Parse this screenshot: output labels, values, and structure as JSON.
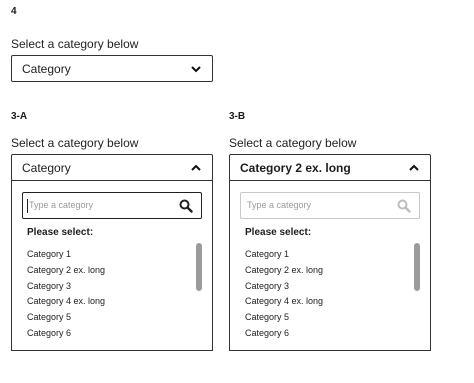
{
  "section4": {
    "label": "4",
    "prompt": "Select a category below",
    "select_value": "Category"
  },
  "section3a": {
    "label": "3-A",
    "prompt": "Select a category below",
    "select_value": "Category",
    "search_placeholder": "Type a category",
    "please_select": "Please select:",
    "options": [
      "Category 1",
      "Category 2 ex. long",
      "Category 3",
      "Category 4 ex. long",
      "Category 5",
      "Category 6"
    ]
  },
  "section3b": {
    "label": "3-B",
    "prompt": "Select a category below",
    "select_value": "Category 2 ex. long",
    "search_placeholder": "Type a category",
    "please_select": "Please select:",
    "options": [
      "Category 1",
      "Category 2 ex. long",
      "Category 3",
      "Category 4 ex. long",
      "Category 5",
      "Category 6"
    ]
  },
  "icons": {
    "chevron_down": "chevron-down-icon",
    "chevron_up": "chevron-up-icon",
    "search": "search-icon"
  },
  "colors": {
    "border": "#333333",
    "placeholder": "#9a9a9a",
    "scrollbar": "#9b9b9b",
    "search_border_active": "#222222",
    "search_border_inactive": "#c8c8c8",
    "search_icon_active": "#222222",
    "search_icon_inactive": "#bdbdbd"
  }
}
